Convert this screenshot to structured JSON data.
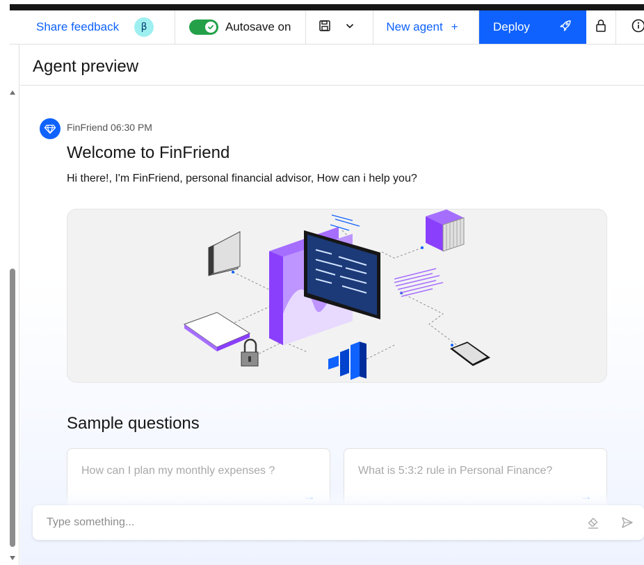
{
  "toolbar": {
    "share_feedback": "Share feedback",
    "beta_badge": "β",
    "autosave_label": "Autosave on",
    "autosave_on": true,
    "new_agent_label": "New agent",
    "new_agent_plus": "+",
    "deploy_label": "Deploy"
  },
  "panel": {
    "title": "Agent preview"
  },
  "message": {
    "sender": "FinFriend",
    "time": "06:30 PM",
    "title": "Welcome to FinFriend",
    "text": "Hi there!, I'm FinFriend, personal financial advisor, How can i help you?"
  },
  "sample": {
    "heading": "Sample questions",
    "questions": [
      "How can I plan my monthly expenses ?",
      "What is 5:3:2 rule in Personal Finance?"
    ],
    "arrow": "→"
  },
  "input": {
    "placeholder": "Type something..."
  },
  "colors": {
    "primary": "#0f62fe",
    "toggle": "#24a148",
    "beta_bg": "#9ef0f0",
    "illustration_purple": "#8a3ffc"
  },
  "icons": {
    "save": "save-icon",
    "chevron": "chevron-down-icon",
    "rocket": "rocket-icon",
    "lock": "lock-icon",
    "info": "info-icon",
    "avatar": "diamond-icon",
    "clear": "eraser-icon",
    "send": "send-icon"
  }
}
